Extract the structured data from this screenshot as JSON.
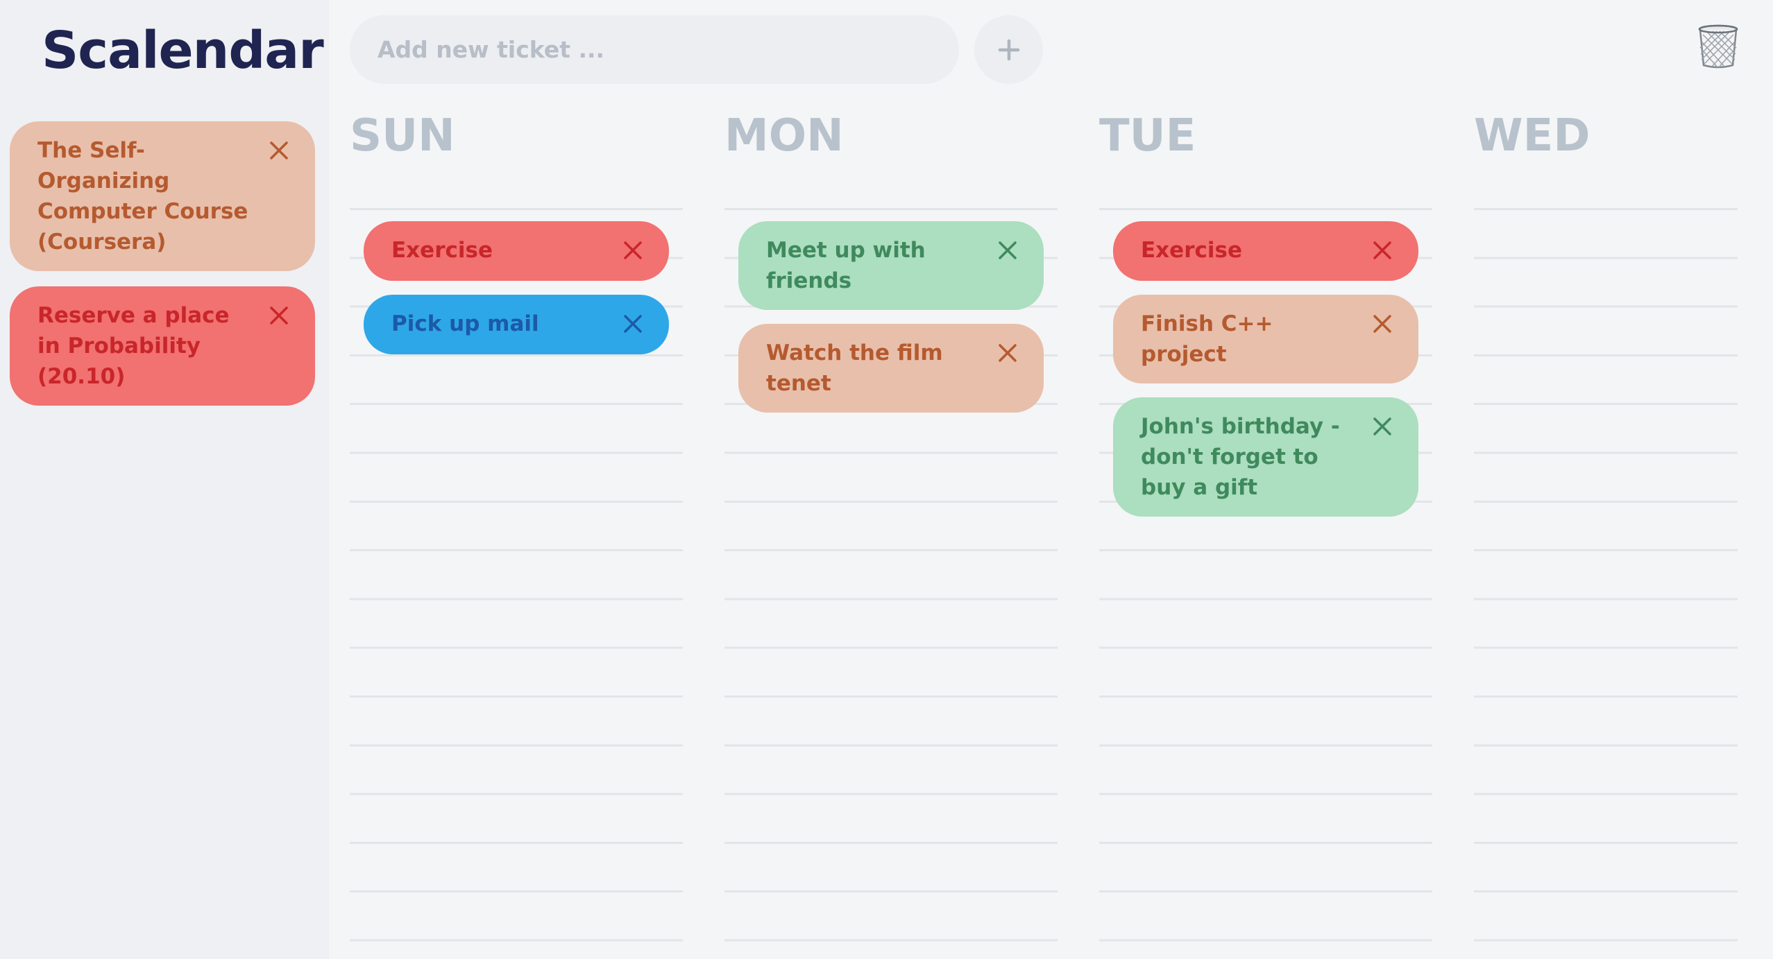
{
  "app": {
    "logo": "Scalendar"
  },
  "new_ticket": {
    "placeholder": "Add new ticket ..."
  },
  "icons": {
    "add": "plus-icon",
    "trash": "trash-bin-icon",
    "remove": "close-icon"
  },
  "colors": {
    "salmon_bg": "#e8bfab",
    "salmon_text": "#b55a2f",
    "red_bg": "#f27171",
    "red_text": "#c8262a",
    "green_bg": "#acdec0",
    "green_text": "#3f8a5d",
    "blue_bg": "#2ea7e8",
    "blue_text": "#1b5aa8",
    "logo": "#1f2550",
    "day_header": "#b8c2cd"
  },
  "backlog": [
    {
      "label": "The Self-Organizing Computer Course (Coursera)",
      "color": "salmon"
    },
    {
      "label": "Reserve a place in Probability (20.10)",
      "color": "red"
    }
  ],
  "days": [
    {
      "name": "SUN",
      "tickets": [
        {
          "label": "Exercise",
          "color": "red"
        },
        {
          "label": "Pick up mail",
          "color": "blue"
        }
      ]
    },
    {
      "name": "MON",
      "tickets": [
        {
          "label": "Meet up with friends",
          "color": "green"
        },
        {
          "label": "Watch the film tenet",
          "color": "salmon"
        }
      ]
    },
    {
      "name": "TUE",
      "tickets": [
        {
          "label": "Exercise",
          "color": "red"
        },
        {
          "label": "Finish C++ project",
          "color": "salmon"
        },
        {
          "label": "John's birthday - don't forget to buy a gift",
          "color": "green"
        }
      ]
    },
    {
      "name": "WED",
      "tickets": []
    }
  ]
}
